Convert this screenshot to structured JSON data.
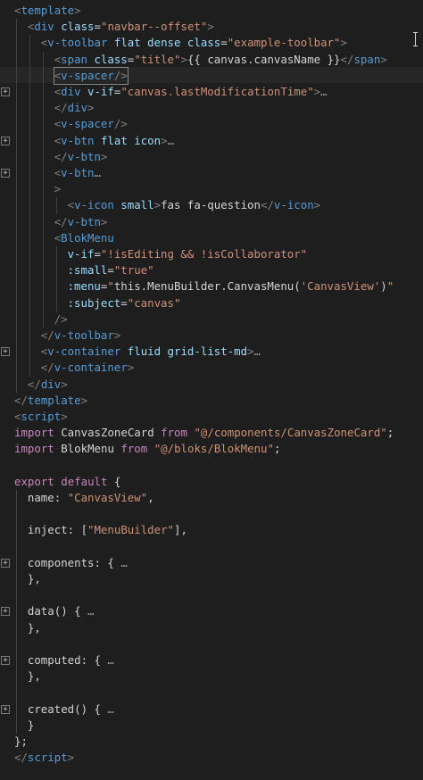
{
  "editor": {
    "language": "vue",
    "fold_icon": "plus-box-icon",
    "colors": {
      "background": "#1e1e1e",
      "punctuation": "#808080",
      "tag": "#569cd6",
      "attribute": "#9cdcfe",
      "string": "#ce9178",
      "keyword": "#c586c0",
      "text": "#d4d4d4"
    },
    "lines": [
      {
        "fold": false,
        "indent": 0,
        "tokens": [
          [
            "p",
            "<"
          ],
          [
            "t",
            "template"
          ],
          [
            "p",
            ">"
          ]
        ]
      },
      {
        "fold": false,
        "indent": 1,
        "tokens": [
          [
            "p",
            "<"
          ],
          [
            "t",
            "div"
          ],
          [
            "x",
            " "
          ],
          [
            "a",
            "class"
          ],
          [
            "x",
            "="
          ],
          [
            "s",
            "\"navbar--offset\""
          ],
          [
            "p",
            ">"
          ]
        ]
      },
      {
        "fold": false,
        "indent": 2,
        "tokens": [
          [
            "p",
            "<"
          ],
          [
            "t",
            "v-toolbar"
          ],
          [
            "x",
            " "
          ],
          [
            "a",
            "flat dense class"
          ],
          [
            "x",
            "="
          ],
          [
            "s",
            "\"example-toolbar\""
          ],
          [
            "p",
            ">"
          ]
        ]
      },
      {
        "fold": false,
        "indent": 3,
        "tokens": [
          [
            "p",
            "<"
          ],
          [
            "t",
            "span"
          ],
          [
            "x",
            " "
          ],
          [
            "a",
            "class"
          ],
          [
            "x",
            "="
          ],
          [
            "s",
            "\"title\""
          ],
          [
            "p",
            ">"
          ],
          [
            "x",
            "{{ canvas.canvasName }}"
          ],
          [
            "p",
            "</"
          ],
          [
            "t",
            "span"
          ],
          [
            "p",
            ">"
          ]
        ]
      },
      {
        "fold": false,
        "indent": 3,
        "tokens": [
          [
            "p",
            "<"
          ],
          [
            "t",
            "v-spacer"
          ],
          [
            "p",
            "/>"
          ]
        ],
        "box": true
      },
      {
        "fold": true,
        "indent": 3,
        "tokens": [
          [
            "p",
            "<"
          ],
          [
            "t",
            "div"
          ],
          [
            "x",
            " "
          ],
          [
            "a",
            "v-if"
          ],
          [
            "x",
            "="
          ],
          [
            "s",
            "\"canvas.lastModificationTime\""
          ],
          [
            "p",
            ">"
          ],
          [
            "f",
            "…"
          ]
        ]
      },
      {
        "fold": false,
        "indent": 3,
        "tokens": [
          [
            "p",
            "</"
          ],
          [
            "t",
            "div"
          ],
          [
            "p",
            ">"
          ]
        ]
      },
      {
        "fold": false,
        "indent": 3,
        "tokens": [
          [
            "p",
            "<"
          ],
          [
            "t",
            "v-spacer"
          ],
          [
            "p",
            "/>"
          ]
        ]
      },
      {
        "fold": true,
        "indent": 3,
        "tokens": [
          [
            "p",
            "<"
          ],
          [
            "t",
            "v-btn"
          ],
          [
            "x",
            " "
          ],
          [
            "a",
            "flat icon"
          ],
          [
            "p",
            ">"
          ],
          [
            "f",
            "…"
          ]
        ]
      },
      {
        "fold": false,
        "indent": 3,
        "tokens": [
          [
            "p",
            "</"
          ],
          [
            "t",
            "v-btn"
          ],
          [
            "p",
            ">"
          ]
        ]
      },
      {
        "fold": true,
        "indent": 3,
        "tokens": [
          [
            "p",
            "<"
          ],
          [
            "t",
            "v-btn"
          ],
          [
            "f",
            "…"
          ]
        ]
      },
      {
        "fold": false,
        "indent": 3,
        "tokens": [
          [
            "p",
            ">"
          ]
        ]
      },
      {
        "fold": false,
        "indent": 4,
        "tokens": [
          [
            "p",
            "<"
          ],
          [
            "t",
            "v-icon"
          ],
          [
            "x",
            " "
          ],
          [
            "a",
            "small"
          ],
          [
            "p",
            ">"
          ],
          [
            "x",
            "fas fa-question"
          ],
          [
            "p",
            "</"
          ],
          [
            "t",
            "v-icon"
          ],
          [
            "p",
            ">"
          ]
        ]
      },
      {
        "fold": false,
        "indent": 3,
        "tokens": [
          [
            "p",
            "</"
          ],
          [
            "t",
            "v-btn"
          ],
          [
            "p",
            ">"
          ]
        ]
      },
      {
        "fold": false,
        "indent": 3,
        "tokens": [
          [
            "p",
            "<"
          ],
          [
            "t",
            "BlokMenu"
          ]
        ]
      },
      {
        "fold": false,
        "indent": 4,
        "tokens": [
          [
            "a",
            "v-if"
          ],
          [
            "x",
            "="
          ],
          [
            "s",
            "\"!isEditing && !isCollaborator\""
          ]
        ]
      },
      {
        "fold": false,
        "indent": 4,
        "tokens": [
          [
            "a",
            ":small"
          ],
          [
            "x",
            "="
          ],
          [
            "s",
            "\"true\""
          ]
        ]
      },
      {
        "fold": false,
        "indent": 4,
        "tokens": [
          [
            "a",
            ":menu"
          ],
          [
            "x",
            "="
          ],
          [
            "s",
            "\""
          ],
          [
            "x",
            "this.MenuBuilder.CanvasMenu("
          ],
          [
            "s",
            "'CanvasView'"
          ],
          [
            "x",
            ")"
          ],
          [
            "s",
            "\""
          ]
        ]
      },
      {
        "fold": false,
        "indent": 4,
        "tokens": [
          [
            "a",
            ":subject"
          ],
          [
            "x",
            "="
          ],
          [
            "s",
            "\"canvas\""
          ]
        ]
      },
      {
        "fold": false,
        "indent": 3,
        "tokens": [
          [
            "p",
            "/>"
          ]
        ]
      },
      {
        "fold": false,
        "indent": 2,
        "tokens": [
          [
            "p",
            "</"
          ],
          [
            "t",
            "v-toolbar"
          ],
          [
            "p",
            ">"
          ]
        ]
      },
      {
        "fold": true,
        "indent": 2,
        "tokens": [
          [
            "p",
            "<"
          ],
          [
            "t",
            "v-container"
          ],
          [
            "x",
            " "
          ],
          [
            "a",
            "fluid grid-list-md"
          ],
          [
            "p",
            ">"
          ],
          [
            "f",
            "…"
          ]
        ]
      },
      {
        "fold": false,
        "indent": 2,
        "tokens": [
          [
            "p",
            "</"
          ],
          [
            "t",
            "v-container"
          ],
          [
            "p",
            ">"
          ]
        ]
      },
      {
        "fold": false,
        "indent": 1,
        "tokens": [
          [
            "p",
            "</"
          ],
          [
            "t",
            "div"
          ],
          [
            "p",
            ">"
          ]
        ]
      },
      {
        "fold": false,
        "indent": 0,
        "tokens": [
          [
            "p",
            "</"
          ],
          [
            "t",
            "template"
          ],
          [
            "p",
            ">"
          ]
        ]
      },
      {
        "fold": false,
        "indent": 0,
        "tokens": [
          [
            "p",
            "<"
          ],
          [
            "t",
            "script"
          ],
          [
            "p",
            ">"
          ]
        ]
      },
      {
        "fold": false,
        "indent": 0,
        "tokens": [
          [
            "k",
            "import"
          ],
          [
            "x",
            " CanvasZoneCard "
          ],
          [
            "k",
            "from"
          ],
          [
            "x",
            " "
          ],
          [
            "s",
            "\"@/components/CanvasZoneCard\""
          ],
          [
            "x",
            ";"
          ]
        ]
      },
      {
        "fold": false,
        "indent": 0,
        "tokens": [
          [
            "k",
            "import"
          ],
          [
            "x",
            " BlokMenu "
          ],
          [
            "k",
            "from"
          ],
          [
            "x",
            " "
          ],
          [
            "s",
            "\"@/bloks/BlokMenu\""
          ],
          [
            "x",
            ";"
          ]
        ]
      },
      {
        "fold": false,
        "indent": 0,
        "tokens": []
      },
      {
        "fold": false,
        "indent": 0,
        "tokens": [
          [
            "k",
            "export"
          ],
          [
            "x",
            " "
          ],
          [
            "k",
            "default"
          ],
          [
            "x",
            " {"
          ]
        ]
      },
      {
        "fold": false,
        "indent": 1,
        "tokens": [
          [
            "x",
            "name: "
          ],
          [
            "s",
            "\"CanvasView\""
          ],
          [
            "x",
            ","
          ]
        ]
      },
      {
        "fold": false,
        "indent": 0,
        "tokens": []
      },
      {
        "fold": false,
        "indent": 1,
        "tokens": [
          [
            "x",
            "inject: ["
          ],
          [
            "s",
            "\"MenuBuilder\""
          ],
          [
            "x",
            "],"
          ]
        ]
      },
      {
        "fold": false,
        "indent": 0,
        "tokens": []
      },
      {
        "fold": true,
        "indent": 1,
        "tokens": [
          [
            "x",
            "components: {"
          ],
          [
            "f",
            " …"
          ]
        ]
      },
      {
        "fold": false,
        "indent": 1,
        "tokens": [
          [
            "x",
            "},"
          ]
        ]
      },
      {
        "fold": false,
        "indent": 0,
        "tokens": []
      },
      {
        "fold": true,
        "indent": 1,
        "tokens": [
          [
            "x",
            "data() {"
          ],
          [
            "f",
            " …"
          ]
        ]
      },
      {
        "fold": false,
        "indent": 1,
        "tokens": [
          [
            "x",
            "},"
          ]
        ]
      },
      {
        "fold": false,
        "indent": 0,
        "tokens": []
      },
      {
        "fold": true,
        "indent": 1,
        "tokens": [
          [
            "x",
            "computed: {"
          ],
          [
            "f",
            " …"
          ]
        ]
      },
      {
        "fold": false,
        "indent": 1,
        "tokens": [
          [
            "x",
            "},"
          ]
        ]
      },
      {
        "fold": false,
        "indent": 0,
        "tokens": []
      },
      {
        "fold": true,
        "indent": 1,
        "tokens": [
          [
            "x",
            "created() {"
          ],
          [
            "f",
            " …"
          ]
        ]
      },
      {
        "fold": false,
        "indent": 1,
        "tokens": [
          [
            "x",
            "}"
          ]
        ]
      },
      {
        "fold": false,
        "indent": 0,
        "tokens": [
          [
            "x",
            "};"
          ]
        ]
      },
      {
        "fold": false,
        "indent": 0,
        "tokens": [
          [
            "p",
            "</"
          ],
          [
            "t",
            "script"
          ],
          [
            "p",
            ">"
          ]
        ]
      }
    ]
  }
}
